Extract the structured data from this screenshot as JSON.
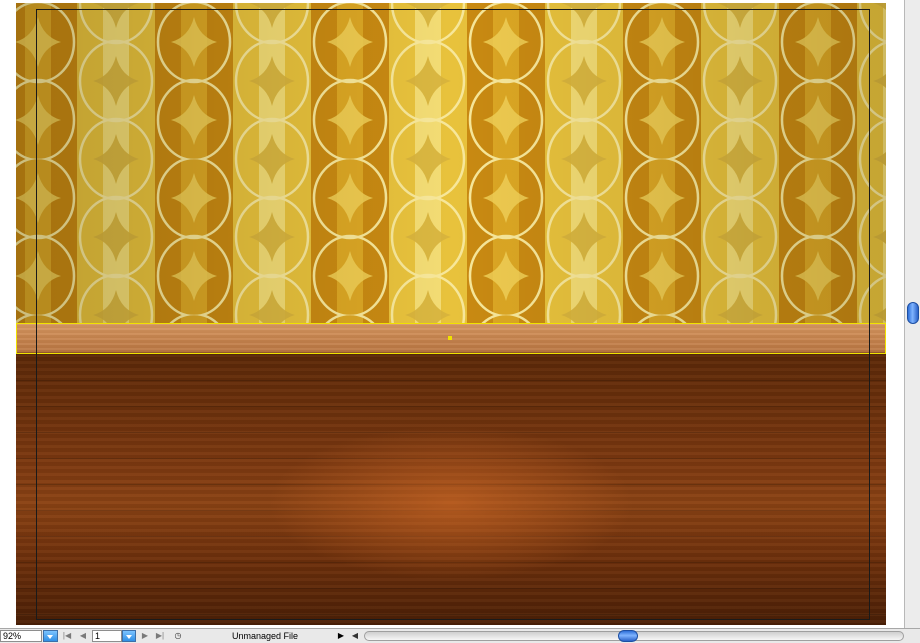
{
  "status_bar": {
    "zoom_value": "92%",
    "page_number": "1",
    "status_text": "Unmanaged File",
    "icons": {
      "first_page": "first-page-icon",
      "prev_page": "previous-page-icon",
      "next_page": "next-page-icon",
      "last_page": "last-page-icon",
      "status_menu": "play-icon",
      "scroll_left": "scroll-left-icon"
    }
  },
  "colors": {
    "wallpaper_gold": "#d49a14",
    "wallpaper_light": "#f2e08a",
    "shelf_wood": "#c98650",
    "floor_wood": "#7b3810",
    "selection": "#f0e200",
    "scroll_thumb": "#4a8cf0"
  }
}
